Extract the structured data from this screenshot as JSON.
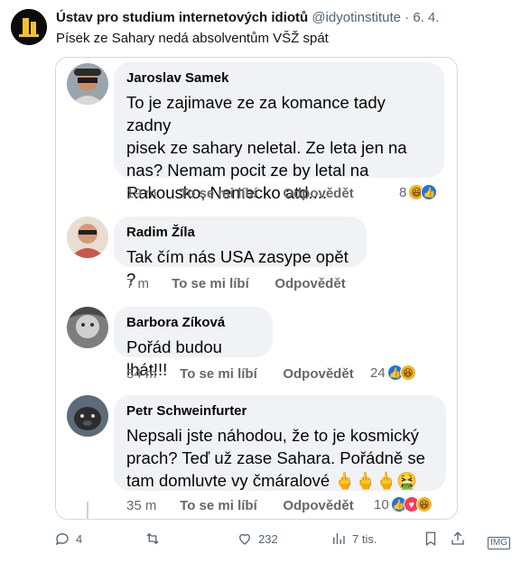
{
  "tweet": {
    "author_name": "Ústav pro studium internetových idiotů",
    "handle": "@idyotinstitute",
    "separator": "·",
    "date": "6. 4.",
    "text": "Písek ze Sahary nedá absolventům VŠŽ spát"
  },
  "comments": [
    {
      "name": "Jaroslav Samek",
      "lines": [
        "To je zajimave ze za komance tady zadny",
        "pisek ze sahary neletal. Ze leta jen na",
        "nas? Nemam pocit ze by letal na",
        "Rakousko, Nemecko atd...."
      ],
      "time": "19 m",
      "like_label": "To se mi líbí",
      "reply_label": "Odpovědět",
      "reaction_count": "8",
      "reactions": [
        "haha",
        "like"
      ]
    },
    {
      "name": "Radim Žíla",
      "lines": [
        "Tak čím nás USA zasype opět ?"
      ],
      "time": "7 m",
      "like_label": "To se mi líbí",
      "reply_label": "Odpovědět",
      "reaction_count": "",
      "reactions": []
    },
    {
      "name": "Barbora Zíková",
      "lines": [
        "Pořád budou lhát!!!"
      ],
      "time": "54 m",
      "like_label": "To se mi líbí",
      "reply_label": "Odpovědět",
      "reaction_count": "24",
      "reactions": [
        "like",
        "haha"
      ]
    },
    {
      "name": "Petr Schweinfurter",
      "lines": [
        "Nepsali jste náhodou, že to je kosmický",
        "prach? Teď už zase Sahara. Pořádně se",
        "tam domluvte vy čmáralové 🖕🖕🖕🤮"
      ],
      "time": "35 m",
      "like_label": "To se mi líbí",
      "reply_label": "Odpovědět",
      "reaction_count": "10",
      "reactions": [
        "like",
        "love",
        "haha"
      ]
    }
  ],
  "actions": {
    "replies": "4",
    "retweets": "",
    "likes": "232",
    "views": "7 tis."
  },
  "badge": "IMG",
  "colors": {
    "bubble": "#f0f2f5",
    "meta": "#65676b",
    "accent_like": "#1b74e4",
    "accent_love": "#f33e58",
    "accent_haha": "#f7b125"
  }
}
